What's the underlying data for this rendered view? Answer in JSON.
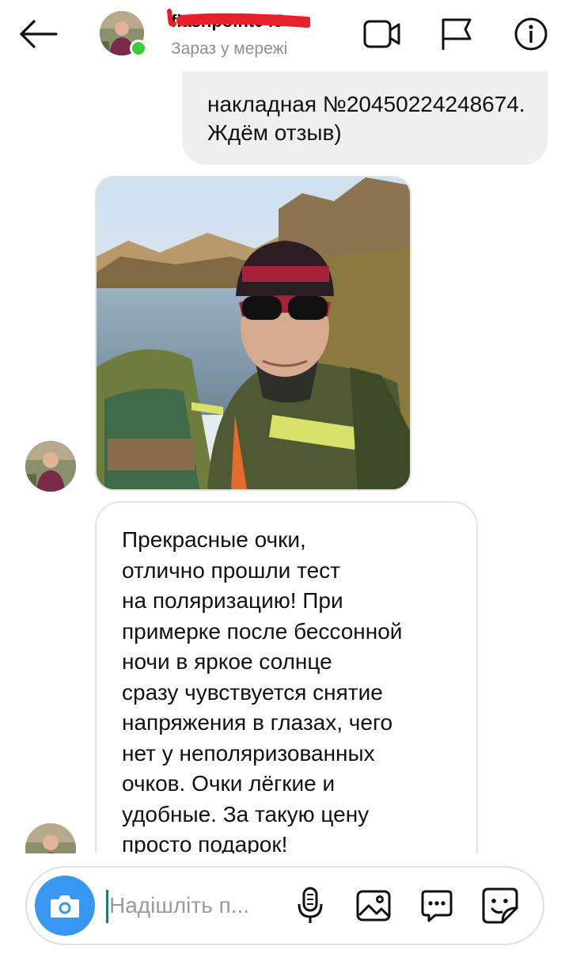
{
  "header": {
    "username": "flashpoint045",
    "status": "Зараз у мережі",
    "icons": [
      "back-arrow-icon",
      "video-call-icon",
      "flag-icon",
      "info-icon"
    ]
  },
  "messages": {
    "outgoing_text": "накладная №20450224248674. Ждём отзыв)",
    "incoming_review": "Прекрасные очки,\nотлично прошли тест\nна поляризацию! При\nпримерке после бессонной\nночи в яркое солнце\nсразу чувствуется снятие\nнапряжения в глазах, чего\nнет у неполяризованных\nочков. Очки лёгкие и\nудобные. За такую цену\nпросто подарок!"
  },
  "composer": {
    "placeholder": "Надішліть п...",
    "value": ""
  },
  "colors": {
    "accent": "#3897f0",
    "online": "#3ccb3c",
    "bubble_out": "#efefef",
    "border": "#e4e4e4",
    "muted": "#8e8e8e"
  }
}
